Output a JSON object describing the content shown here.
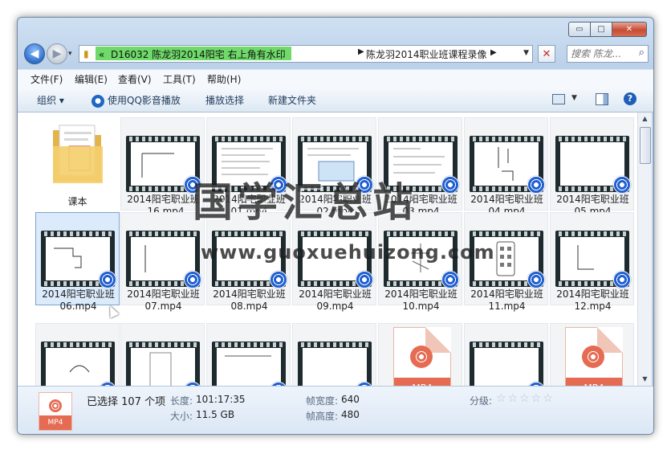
{
  "window": {
    "controls": {
      "minimize": "▭",
      "maximize": "□",
      "close": "✕"
    }
  },
  "nav": {
    "recent_label": "«",
    "address_prefix_label": "D16032 陈龙羽2014阳宅 右上角有水印",
    "address_folder": "陈龙羽2014职业班课程录像",
    "search_placeholder": "搜索 陈龙..."
  },
  "menu": {
    "items": [
      "文件(F)",
      "编辑(E)",
      "查看(V)",
      "工具(T)",
      "帮助(H)"
    ]
  },
  "toolbar": {
    "organize": "组织 ▾",
    "play_qq": "使用QQ影音播放",
    "playlist": "播放选择",
    "new_folder": "新建文件夹"
  },
  "files": [
    {
      "line1": "课本",
      "line2": "",
      "kind": "folder"
    },
    {
      "line1": "2014阳宅职业班",
      "line2": "_16.mp4",
      "kind": "video"
    },
    {
      "line1": "2014阳宅职业班",
      "line2": "01.mp4",
      "kind": "video"
    },
    {
      "line1": "2014阳宅职业班",
      "line2": "02.mp4",
      "kind": "video"
    },
    {
      "line1": "2014阳宅职业班",
      "line2": "03.mp4",
      "kind": "video"
    },
    {
      "line1": "2014阳宅职业班",
      "line2": "04.mp4",
      "kind": "video"
    },
    {
      "line1": "2014阳宅职业班",
      "line2": "05.mp4",
      "kind": "video"
    },
    {
      "line1": "2014阳宅职业班",
      "line2": "06.mp4",
      "kind": "video"
    },
    {
      "line1": "2014阳宅职业班",
      "line2": "07.mp4",
      "kind": "video"
    },
    {
      "line1": "2014阳宅职业班",
      "line2": "08.mp4",
      "kind": "video"
    },
    {
      "line1": "2014阳宅职业班",
      "line2": "09.mp4",
      "kind": "video"
    },
    {
      "line1": "2014阳宅职业班",
      "line2": "10.mp4",
      "kind": "video"
    },
    {
      "line1": "2014阳宅职业班",
      "line2": "11.mp4",
      "kind": "video"
    },
    {
      "line1": "2014阳宅职业班",
      "line2": "12.mp4",
      "kind": "video"
    },
    {
      "line1": "",
      "line2": "",
      "kind": "video"
    },
    {
      "line1": "",
      "line2": "",
      "kind": "video"
    },
    {
      "line1": "",
      "line2": "",
      "kind": "video"
    },
    {
      "line1": "",
      "line2": "",
      "kind": "video"
    },
    {
      "line1": "",
      "line2": "",
      "kind": "mp4-doc",
      "badge": "MP4"
    },
    {
      "line1": "",
      "line2": "",
      "kind": "video"
    },
    {
      "line1": "",
      "line2": "",
      "kind": "mp4-doc",
      "badge": "MP4"
    }
  ],
  "details": {
    "thumb_label": "MP4",
    "selected": "已选择 107 个项",
    "duration_label": "长度:",
    "duration_value": "101:17:35",
    "size_label": "大小:",
    "size_value": "11.5 GB",
    "frame_width_label": "帧宽度:",
    "frame_width_value": "640",
    "frame_height_label": "帧高度:",
    "frame_height_value": "480",
    "rating_label": "分级:",
    "stars": "☆☆☆☆☆"
  },
  "watermark": {
    "cn": "国学汇总站",
    "url": "www.guoxuehuizong.com"
  },
  "icons": [
    "back-arrow-icon",
    "forward-arrow-icon",
    "folder-icon",
    "search-icon",
    "help-icon",
    "qq-player-icon",
    "view-icon",
    "preview-pane-icon"
  ]
}
